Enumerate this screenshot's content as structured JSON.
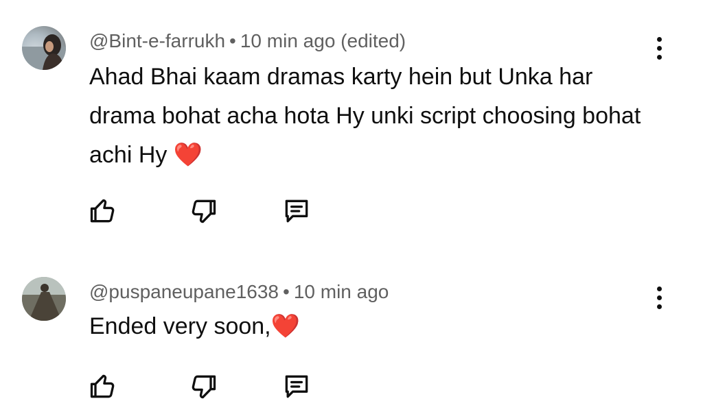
{
  "comments": [
    {
      "author": "@Bint-e-farrukh",
      "separator": "•",
      "time": "10 min ago (edited)",
      "text": "Ahad Bhai kaam dramas karty hein but Unka har drama bohat acha hota Hy unki script choosing bohat achi Hy",
      "emoji": "❤️",
      "icons": {
        "like": "thumbs-up-icon",
        "dislike": "thumbs-down-icon",
        "reply": "comment-icon",
        "more": "more-vert-icon"
      }
    },
    {
      "author": "@puspaneupane1638",
      "separator": "•",
      "time": "10 min ago",
      "text": "Ended very soon,",
      "emoji": "❤️",
      "icons": {
        "like": "thumbs-up-icon",
        "dislike": "thumbs-down-icon",
        "reply": "comment-icon",
        "more": "more-vert-icon"
      }
    }
  ]
}
